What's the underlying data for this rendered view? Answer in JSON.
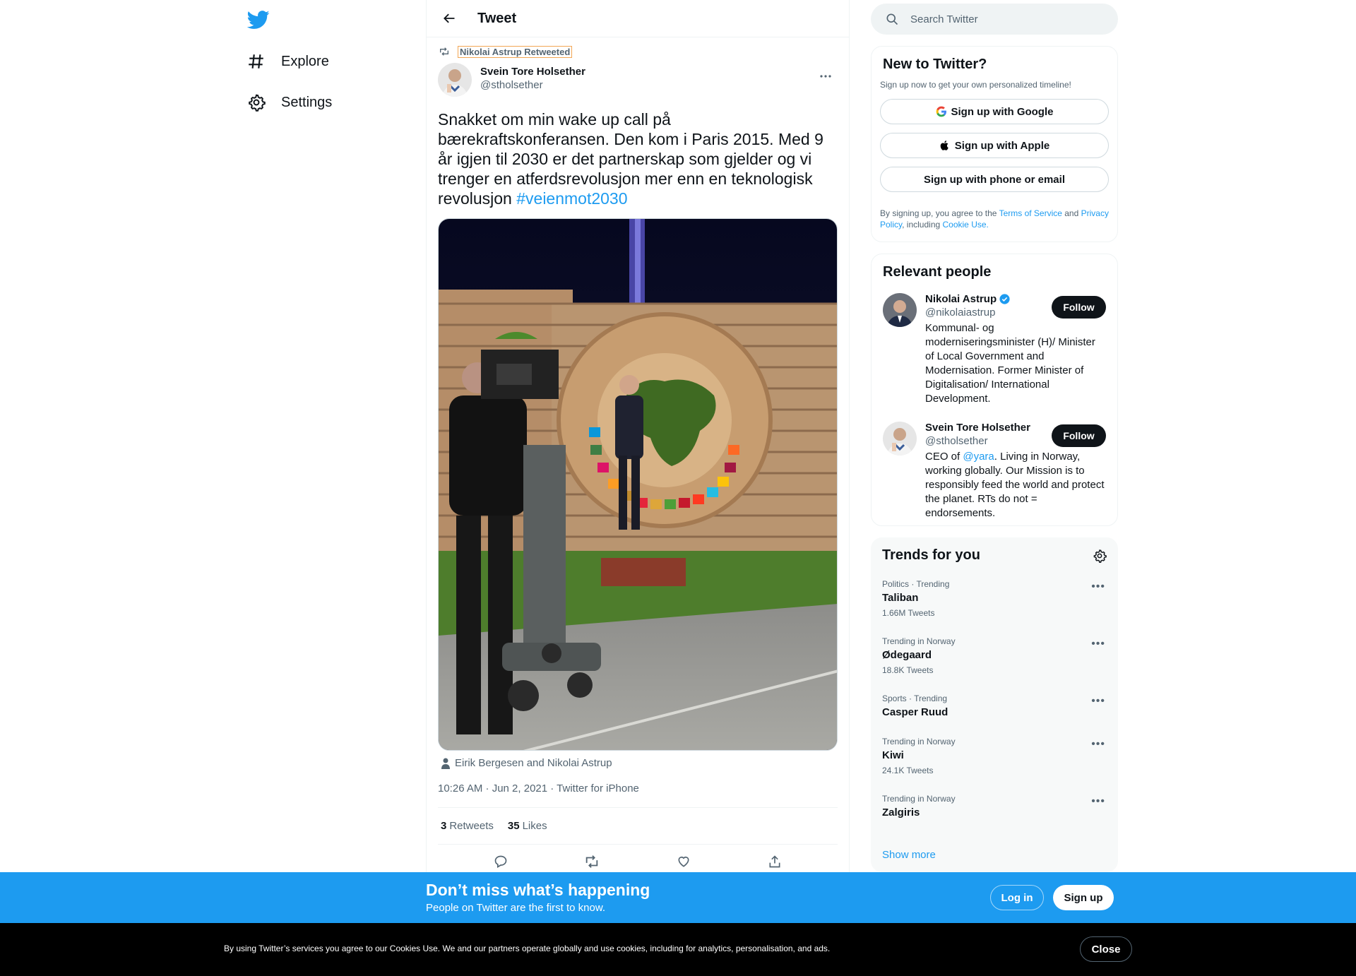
{
  "nav": {
    "logo": "twitter-bird-icon",
    "items": [
      {
        "label": "Explore",
        "icon": "hashtag-icon"
      },
      {
        "label": "Settings",
        "icon": "gear-icon"
      }
    ]
  },
  "main": {
    "title": "Tweet",
    "tweet": {
      "retweeted_by": "Nikolai Astrup Retweeted",
      "author_name": "Svein Tore Holsether",
      "author_handle": "@stholsether",
      "text": "Snakket om min wake up call på bærekraftskonferansen. Den kom i Paris 2015. Med 9 år igjen til 2030 er det partnerskap som gjelder og vi trenger en atferdsrevolusjon mer enn en teknologisk revolusjon",
      "hashtag": "#veienmot2030",
      "tagged": "Eirik Bergesen and Nikolai Astrup",
      "meta": "10:26 AM · Jun 2, 2021 · Twitter for iPhone",
      "retweets_count": "3",
      "retweets_label": "Retweets",
      "likes_count": "35",
      "likes_label": "Likes"
    }
  },
  "search": {
    "placeholder": "Search Twitter"
  },
  "new_to_twitter": {
    "title": "New to Twitter?",
    "subtitle": "Sign up now to get your own personalized timeline!",
    "buttons": [
      "Sign up with Google",
      "Sign up with Apple",
      "Sign up with phone or email"
    ],
    "legal_prefix": "By signing up, you agree to the ",
    "terms": "Terms of Service",
    "and": " and ",
    "privacy": "Privacy Policy",
    "including": ", including ",
    "cookie": "Cookie Use."
  },
  "relevant_people": {
    "title": "Relevant people",
    "people": [
      {
        "name": "Nikolai Astrup",
        "handle": "@nikolaiastrup",
        "bio": "Kommunal- og moderniseringsminister (H)/ Minister of Local Government and Modernisation. Former Minister of Digitalisation/ International Development.",
        "follow": "Follow"
      },
      {
        "name": "Svein Tore Holsether",
        "handle": "@stholsether",
        "bio_prefix": "CEO of ",
        "bio_mention": "@yara",
        "bio_rest": ". Living in Norway, working globally. Our Mission is to responsibly feed the world and protect the planet. RTs do not = endorsements.",
        "follow": "Follow"
      }
    ]
  },
  "trends": {
    "title": "Trends for you",
    "items": [
      {
        "meta": "Politics · Trending",
        "name": "Taliban",
        "count": "1.66M Tweets"
      },
      {
        "meta": "Trending in Norway",
        "name": "Ødegaard",
        "count": "18.8K Tweets"
      },
      {
        "meta": "Sports · Trending",
        "name": "Casper Ruud",
        "count": ""
      },
      {
        "meta": "Trending in Norway",
        "name": "Kiwi",
        "count": "24.1K Tweets"
      },
      {
        "meta": "Trending in Norway",
        "name": "Zalgiris",
        "count": ""
      }
    ],
    "show_more": "Show more"
  },
  "bottom_bar": {
    "title": "Don’t miss what’s happening",
    "subtitle": "People on Twitter are the first to know.",
    "login": "Log in",
    "signup": "Sign up"
  },
  "cookie_bar": {
    "text": "By using Twitter’s services you agree to our Cookies Use. We and our partners operate globally and use cookies, including for analytics, personalisation, and ads.",
    "close": "Close"
  },
  "colors": {
    "accent": "#1d9bf0",
    "text": "#0f1419",
    "secondary": "#536471"
  }
}
